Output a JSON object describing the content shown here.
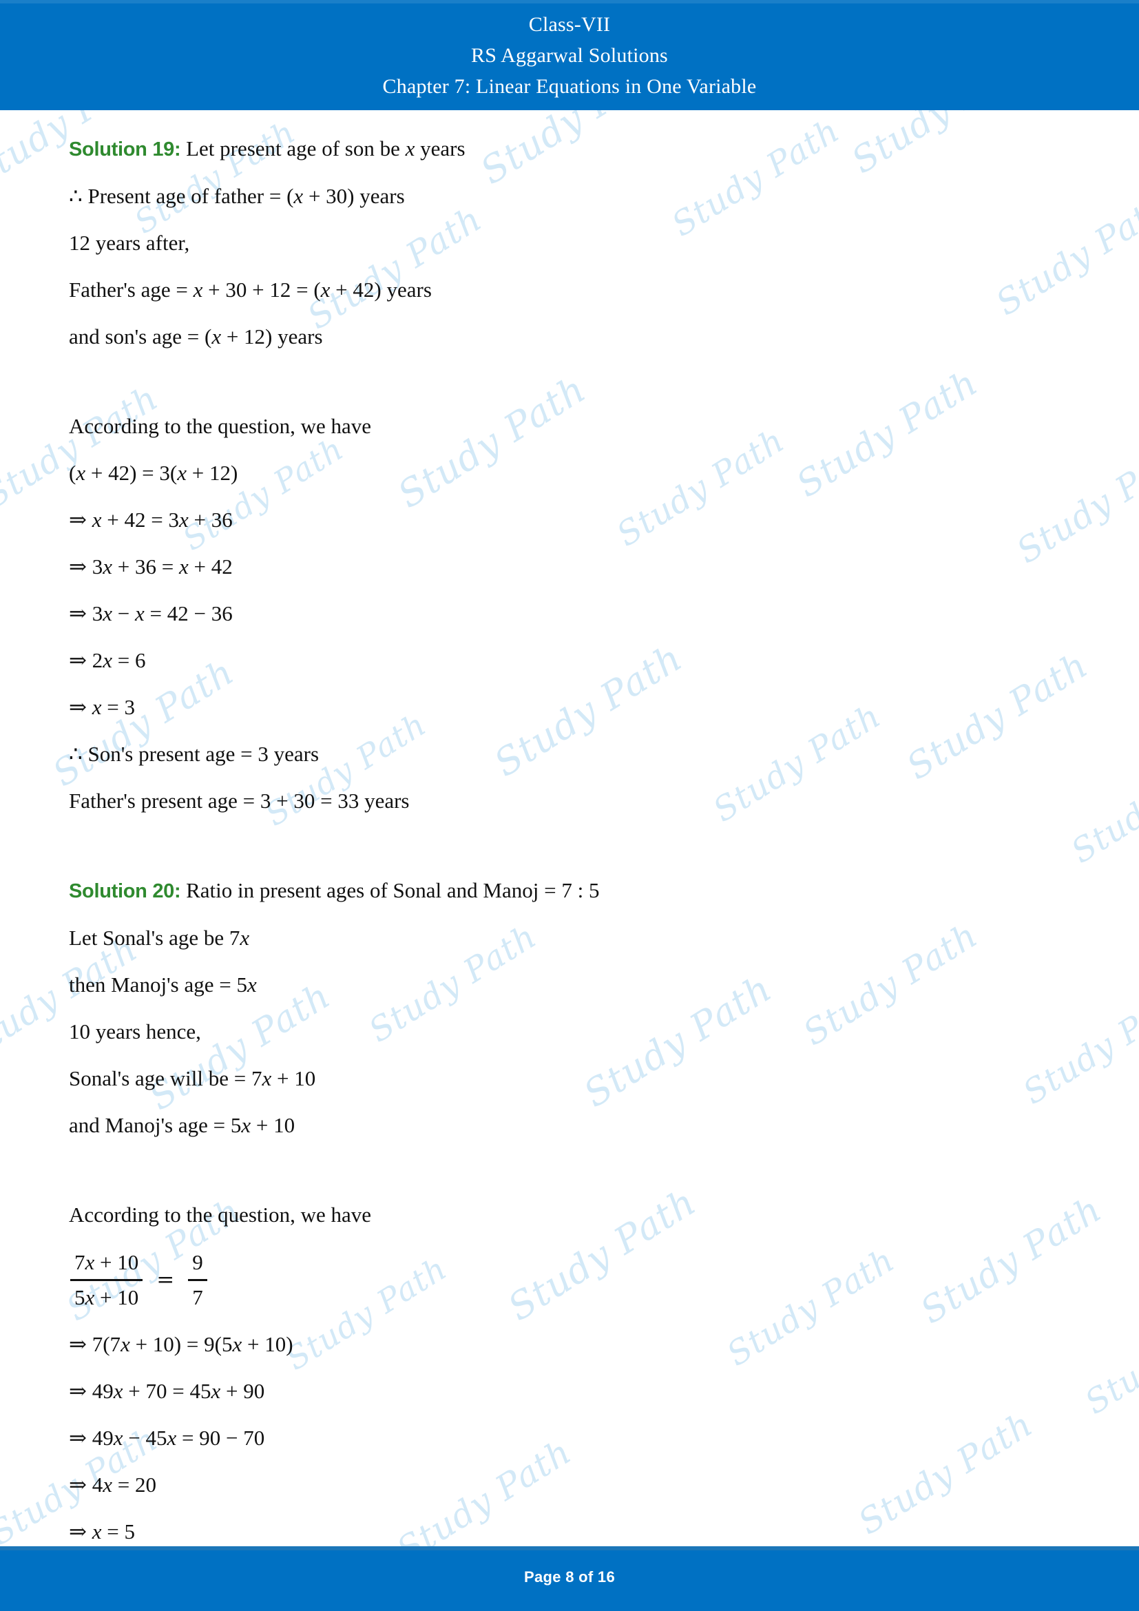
{
  "header": {
    "line1": "Class-VII",
    "line2": "RS Aggarwal Solutions",
    "line3": "Chapter 7: Linear Equations in One Variable",
    "background_color": "#0071c3",
    "text_color": "#ffffff"
  },
  "footer": {
    "page_text": "Page 8 of 16",
    "background_color": "#0071c3",
    "text_color": "#ffffff"
  },
  "watermark": {
    "text": "Study Path",
    "color": "#d3e9f7"
  },
  "solution_label_color": "#2f8a2f",
  "solutions": [
    {
      "label": "Solution 19:",
      "lines": [
        {
          "text": "Let present age of son be x years"
        },
        {
          "text": "∴ Present age of father = (x + 30) years"
        },
        {
          "text": "12 years after,"
        },
        {
          "text": "Father's age = x + 30 + 12 = (x + 42) years"
        },
        {
          "text": "and son's age = (x + 12) years"
        },
        {
          "text": ""
        },
        {
          "text": "According to the question, we have"
        },
        {
          "text": "(x + 42) = 3(x + 12)"
        },
        {
          "text": "⇒ x + 42 = 3x + 36"
        },
        {
          "text": "⇒ 3x + 36 = x + 42"
        },
        {
          "text": "⇒ 3x − x = 42 − 36"
        },
        {
          "text": "⇒ 2x = 6"
        },
        {
          "text": "⇒ x = 3"
        },
        {
          "text": "∴ Son's present age = 3 years"
        },
        {
          "text": "Father's present age = 3 + 30 = 33 years"
        }
      ]
    },
    {
      "label": "Solution 20:",
      "lines": [
        {
          "text": "Ratio in present ages of Sonal and Manoj = 7 : 5"
        },
        {
          "text": "Let Sonal's age be 7x"
        },
        {
          "text": "then Manoj's age = 5x"
        },
        {
          "text": "10 years hence,"
        },
        {
          "text": "Sonal's age will be = 7x + 10"
        },
        {
          "text": "and Manoj's age = 5x + 10"
        },
        {
          "text": ""
        },
        {
          "text": "According to the question, we have"
        }
      ],
      "fraction": {
        "left_numerator": "7x + 10",
        "left_denominator": "5x + 10",
        "equals": "=",
        "right_numerator": "9",
        "right_denominator": "7"
      },
      "lines_after": [
        {
          "text": "⇒ 7(7x + 10) = 9(5x + 10)"
        },
        {
          "text": "⇒ 49x + 70 = 45x + 90"
        },
        {
          "text": "⇒ 49x − 45x = 90 − 70"
        },
        {
          "text": "⇒ 4x = 20"
        },
        {
          "text": "⇒ x = 5"
        }
      ]
    }
  ]
}
